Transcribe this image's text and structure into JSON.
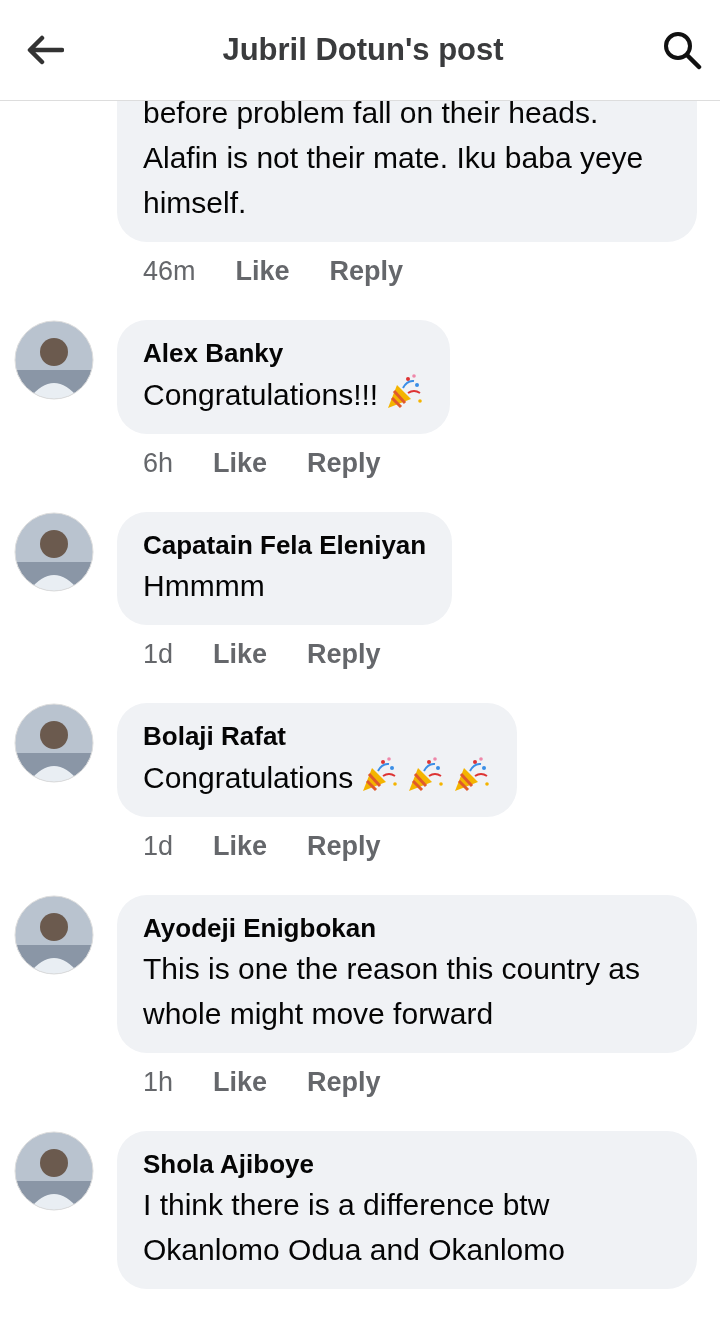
{
  "header": {
    "title": "Jubril Dotun's post"
  },
  "comments": [
    {
      "text": "before problem fall on their heads. Alafin is not their mate. Iku baba yeye himself.",
      "time": "46m",
      "actions": [
        "Like",
        "Reply"
      ]
    },
    {
      "name": "Alex Banky",
      "text": "Congratulations!!!",
      "emojis": [
        {
          "kind": "party-popper"
        }
      ],
      "time": "6h",
      "actions": [
        "Like",
        "Reply"
      ]
    },
    {
      "name": "Capatain Fela Eleniyan",
      "text": "Hmmmm",
      "time": "1d",
      "actions": [
        "Like",
        "Reply"
      ]
    },
    {
      "name": "Bolaji Rafat",
      "text": "Congratulations",
      "emojis": [
        {
          "kind": "party-popper"
        },
        {
          "kind": "party-popper"
        },
        {
          "kind": "party-popper"
        }
      ],
      "time": "1d",
      "actions": [
        "Like",
        "Reply"
      ]
    },
    {
      "name": "Ayodeji Enigbokan",
      "text": "This is one the reason this country as whole might move forward",
      "time": "1h",
      "actions": [
        "Like",
        "Reply"
      ]
    },
    {
      "name": "Shola Ajiboye",
      "text": "I think there is a difference btw Okanlomo Odua and Okanlomo"
    }
  ]
}
